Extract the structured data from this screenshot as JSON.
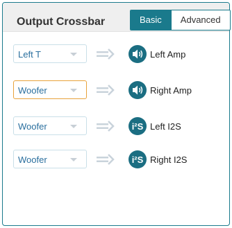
{
  "header": {
    "title": "Output Crossbar",
    "tabs": [
      {
        "label": "Basic",
        "active": true
      },
      {
        "label": "Advanced",
        "active": false
      }
    ]
  },
  "rows": [
    {
      "source": "Left T",
      "icon": "speaker-icon",
      "output": "Left Amp",
      "focused": false
    },
    {
      "source": "Woofer",
      "icon": "speaker-icon",
      "output": "Right Amp",
      "focused": true
    },
    {
      "source": "Woofer",
      "icon": "i2s-icon",
      "output": "Left I2S",
      "focused": false
    },
    {
      "source": "Woofer",
      "icon": "i2s-icon",
      "output": "Right I2S",
      "focused": false
    }
  ],
  "colors": {
    "accent": "#1a7a8c",
    "select_text": "#2a6f9e",
    "focus_border": "#e8a23a",
    "arrow": "#c9d3db"
  },
  "icon_text": {
    "i2s": "i²S"
  }
}
